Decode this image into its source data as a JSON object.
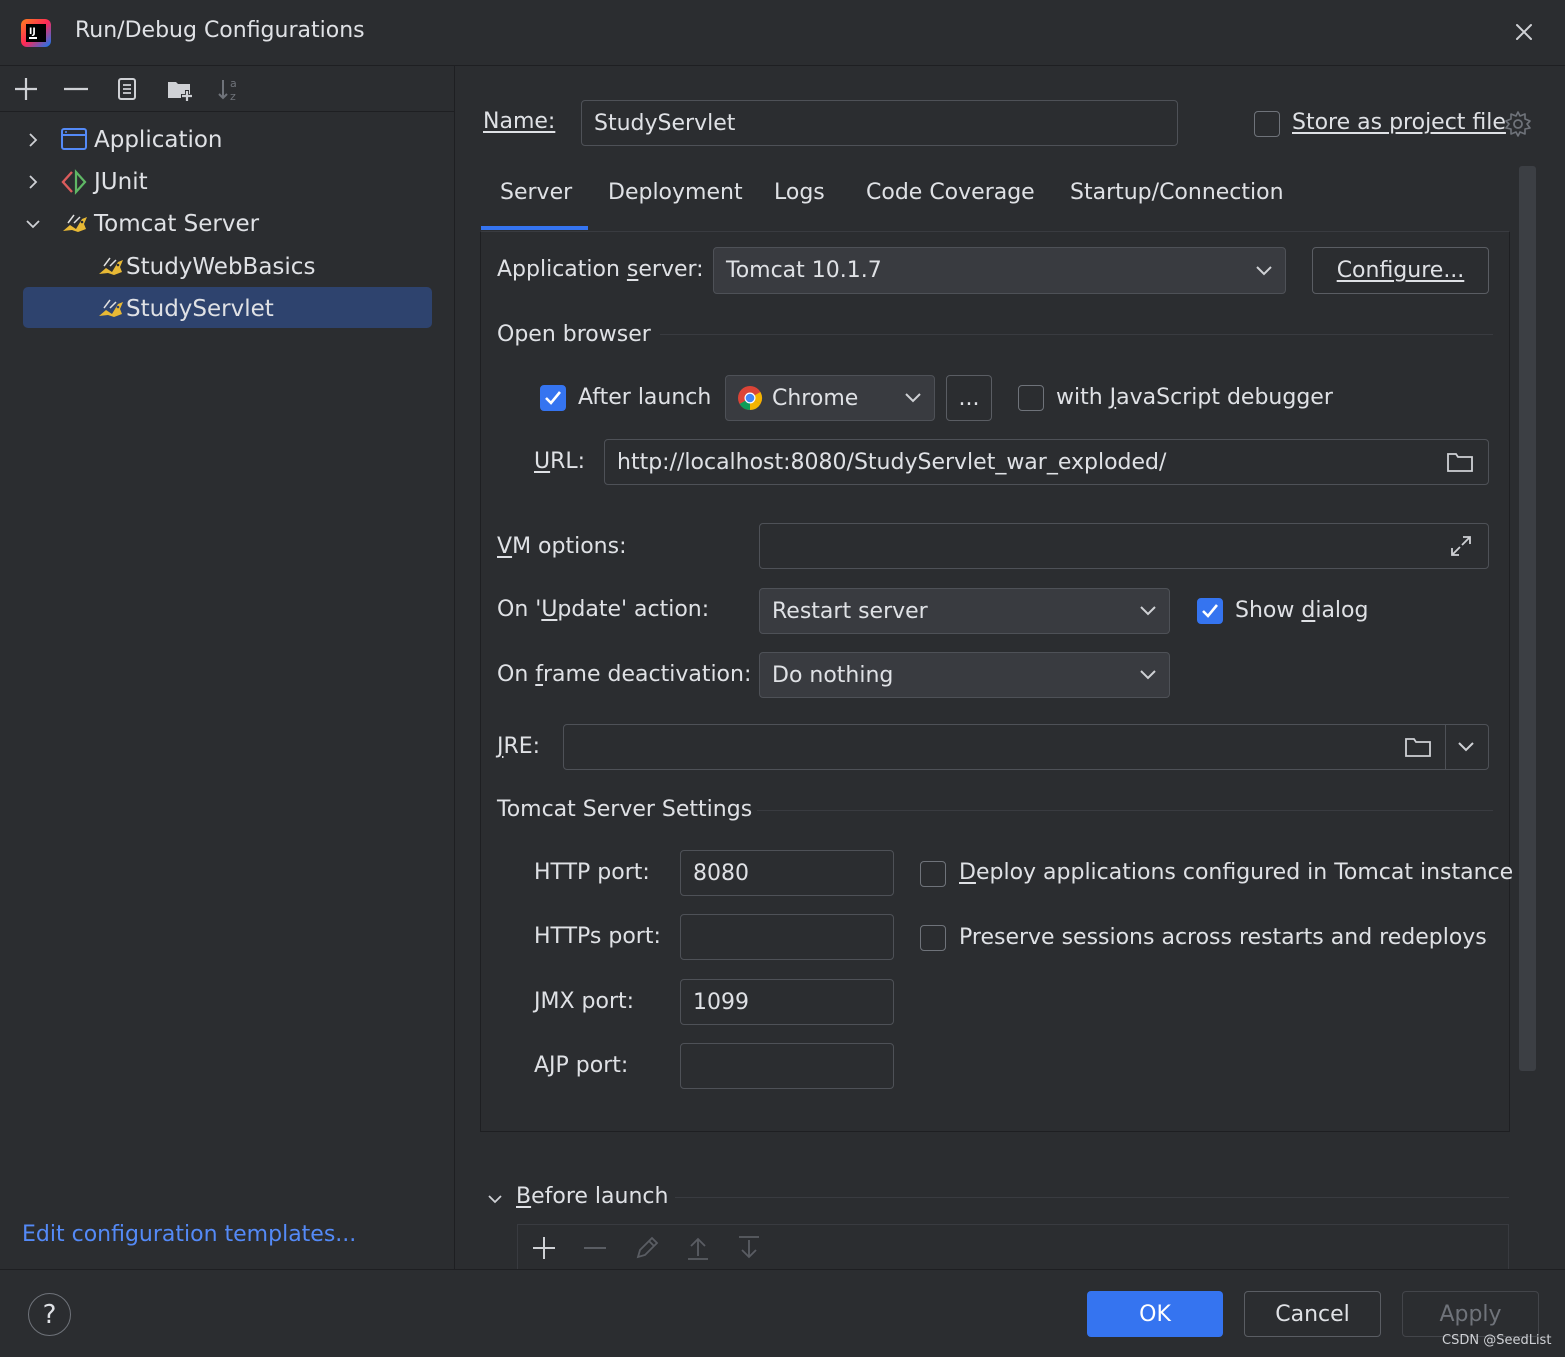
{
  "window": {
    "title": "Run/Debug Configurations"
  },
  "tree": {
    "items": [
      {
        "label": "Application"
      },
      {
        "label": "JUnit"
      },
      {
        "label": "Tomcat Server"
      },
      {
        "label": "StudyWebBasics"
      },
      {
        "label": "StudyServlet"
      }
    ],
    "selected": "StudyServlet",
    "edit_templates_link": "Edit configuration templates..."
  },
  "header": {
    "name_label": "Name:",
    "name_value": "StudyServlet",
    "store_label": "Store as project file",
    "store_checked": false
  },
  "tabs": [
    {
      "label": "Server",
      "active": true
    },
    {
      "label": "Deployment"
    },
    {
      "label": "Logs"
    },
    {
      "label": "Code Coverage"
    },
    {
      "label": "Startup/Connection"
    }
  ],
  "server": {
    "app_server_label": "Application server:",
    "app_server_value": "Tomcat 10.1.7",
    "configure_label": "Configure...",
    "open_browser_title": "Open browser",
    "after_launch_label": "After launch",
    "after_launch_checked": true,
    "browser_value": "Chrome",
    "ellipsis_label": "...",
    "js_debugger_label": "with JavaScript debugger",
    "js_debugger_checked": false,
    "url_label": "URL:",
    "url_value": "http://localhost:8080/StudyServlet_war_exploded/",
    "vm_options_label": "VM options:",
    "vm_options_value": "",
    "on_update_label": "On 'Update' action:",
    "on_update_value": "Restart server",
    "show_dialog_label": "Show dialog",
    "show_dialog_checked": true,
    "on_frame_label": "On frame deactivation:",
    "on_frame_value": "Do nothing",
    "jre_label": "JRE:",
    "jre_value": "",
    "tomcat_settings_title": "Tomcat Server Settings",
    "http_port_label": "HTTP port:",
    "http_port_value": "8080",
    "https_port_label": "HTTPs port:",
    "https_port_value": "",
    "jmx_port_label": "JMX port:",
    "jmx_port_value": "1099",
    "ajp_port_label": "AJP port:",
    "ajp_port_value": "",
    "deploy_apps_label": "Deploy applications configured in Tomcat instance",
    "deploy_apps_checked": false,
    "preserve_sessions_label": "Preserve sessions across restarts and redeploys",
    "preserve_sessions_checked": false
  },
  "before_launch": {
    "title": "Before launch"
  },
  "footer": {
    "help_label": "?",
    "ok_label": "OK",
    "cancel_label": "Cancel",
    "apply_label": "Apply",
    "watermark": "CSDN @SeedList"
  },
  "colors": {
    "background": "#2b2d30",
    "accent": "#3574f0",
    "selection": "#2e436e",
    "link": "#548af7"
  }
}
